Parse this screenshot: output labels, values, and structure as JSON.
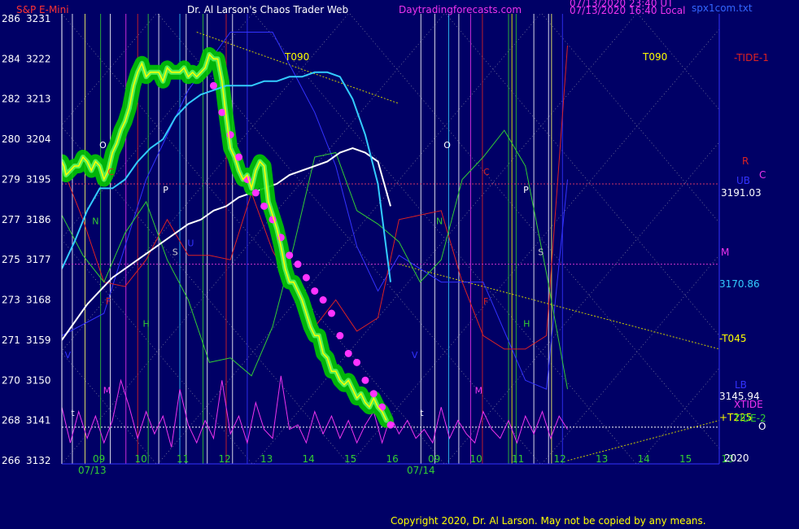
{
  "header": {
    "instrument": "S&P E-Mini",
    "site": "Dr. Al Larson's Chaos Trader Web",
    "url": "Daytradingforecasts.com",
    "stamp1": "07/13/2020 23:40 UT",
    "stamp2": "07/13/2020 16:40 Local",
    "file": "spx1com.txt"
  },
  "footer": {
    "copyright": "Copyright 2020, Dr. Al Larson. May not be copied by any means."
  },
  "colors": {
    "background": "#000066",
    "price": "#ffff00",
    "halo": "#00c800",
    "dots": "#ff33ff",
    "avg_fast": "#33ccff",
    "avg_slow": "#ffffff",
    "tide1": "#dd2222",
    "tide2": "#33cc33",
    "tide_blue": "#3333ff",
    "oscillator": "#ee33ee",
    "trend_dotted": "#cccc00"
  },
  "chart_data": {
    "type": "line",
    "title": "S&P E-Mini",
    "y_axis": {
      "left_labels": [
        "286",
        "284",
        "282",
        "280",
        "279",
        "277",
        "275",
        "273",
        "271",
        "270",
        "268",
        "266"
      ],
      "right_labels": [
        "3231",
        "3222",
        "3213",
        "3204",
        "3195",
        "3186",
        "3177",
        "3168",
        "3159",
        "3150",
        "3141",
        "3132"
      ],
      "ylim": [
        3132,
        3231
      ]
    },
    "x_axis": {
      "hour_labels": [
        "09",
        "10",
        "11",
        "12",
        "13",
        "14",
        "15",
        "16",
        "09",
        "10",
        "11",
        "12",
        "13",
        "14",
        "15",
        "13"
      ],
      "date_labels": [
        "07/13",
        "07/14"
      ]
    },
    "right_labels": [
      {
        "text": "-TIDE-1",
        "color": "#dd2222"
      },
      {
        "text": "R",
        "color": "#dd2222"
      },
      {
        "text": "UB",
        "color": "#3333ff"
      },
      {
        "text": "C",
        "color": "#ee33ee"
      },
      {
        "text": "3191.03",
        "color": "#ffffff"
      },
      {
        "text": "M",
        "color": "#ee33ee"
      },
      {
        "text": "3170.86",
        "color": "#33ccff"
      },
      {
        "text": "-T045",
        "color": "#ffff00"
      },
      {
        "text": "LB",
        "color": "#3333ff"
      },
      {
        "text": "3145.94",
        "color": "#ffffff"
      },
      {
        "text": "XTIDE",
        "color": "#ee33ee"
      },
      {
        "text": "+T225",
        "color": "#ffff00"
      },
      {
        "text": "TIDE-2",
        "color": "#33cc33"
      },
      {
        "text": "O",
        "color": "#ffffff"
      },
      {
        "text": "2020",
        "color": "#ffffff"
      }
    ],
    "top_labels": [
      "T090",
      "T090"
    ],
    "level_lines": [
      {
        "name": "R",
        "value": 3194,
        "color": "#cc3366"
      },
      {
        "name": "M",
        "value": 3176,
        "color": "#cc33cc"
      },
      {
        "name": "close",
        "value": 3139.5,
        "color": "#ffffff"
      }
    ],
    "planet_letters": [
      {
        "t": 0.89,
        "value": 3202,
        "text": "O",
        "color": "#ffffff"
      },
      {
        "t": 1.09,
        "value": 3196,
        "text": "C",
        "color": "#dd2222"
      },
      {
        "t": 0.72,
        "value": 3185,
        "text": "N",
        "color": "#33cc33"
      },
      {
        "t": 2.4,
        "value": 3192,
        "text": "P",
        "color": "#ffffff"
      },
      {
        "t": 2.62,
        "value": 3178,
        "text": "S",
        "color": "#cccccc"
      },
      {
        "t": 1.04,
        "value": 3167,
        "text": "F",
        "color": "#dd2222"
      },
      {
        "t": 1.92,
        "value": 3162,
        "text": "H",
        "color": "#33cc33"
      },
      {
        "t": 2.98,
        "value": 3180,
        "text": "U",
        "color": "#3333ff"
      },
      {
        "t": 0.07,
        "value": 3155,
        "text": "V",
        "color": "#3333ff"
      },
      {
        "t": 0.98,
        "value": 3147,
        "text": "M",
        "color": "#ee33ee"
      },
      {
        "t": 0.22,
        "value": 3142,
        "text": "t",
        "color": "#ffffff"
      },
      {
        "t": 9.06,
        "value": 3202,
        "text": "O",
        "color": "#ffffff"
      },
      {
        "t": 10.0,
        "value": 3196,
        "text": "C",
        "color": "#dd2222"
      },
      {
        "t": 8.88,
        "value": 3185,
        "text": "N",
        "color": "#33cc33"
      },
      {
        "t": 10.95,
        "value": 3192,
        "text": "P",
        "color": "#ffffff"
      },
      {
        "t": 11.3,
        "value": 3178,
        "text": "S",
        "color": "#cccccc"
      },
      {
        "t": 10.0,
        "value": 3167,
        "text": "F",
        "color": "#dd2222"
      },
      {
        "t": 10.95,
        "value": 3162,
        "text": "H",
        "color": "#33cc33"
      },
      {
        "t": 8.3,
        "value": 3155,
        "text": "V",
        "color": "#3333ff"
      },
      {
        "t": 9.8,
        "value": 3147,
        "text": "M",
        "color": "#ee33ee"
      },
      {
        "t": 8.5,
        "value": 3142,
        "text": "t",
        "color": "#ffffff"
      }
    ],
    "vertical_lines": [
      {
        "t": 0.25,
        "color": "#ffffff"
      },
      {
        "t": 0.55,
        "color": "#ffff66"
      },
      {
        "t": 0.92,
        "color": "#33cc33"
      },
      {
        "t": 1.15,
        "color": "#ffffff"
      },
      {
        "t": 1.52,
        "color": "#ee33ee"
      },
      {
        "t": 1.8,
        "color": "#dd2222"
      },
      {
        "t": 2.05,
        "color": "#33cc33"
      },
      {
        "t": 2.3,
        "color": "#ffffff"
      },
      {
        "t": 2.8,
        "color": "#33ccff"
      },
      {
        "t": 2.95,
        "color": "#ffffff"
      },
      {
        "t": 3.35,
        "color": "#33cc33"
      },
      {
        "t": 3.45,
        "color": "#ffffff"
      },
      {
        "t": 3.9,
        "color": "#dd2222"
      },
      {
        "t": 4.05,
        "color": "#ffffff"
      },
      {
        "t": 4.4,
        "color": "#3333ff"
      },
      {
        "t": 8.52,
        "color": "#ffffff"
      },
      {
        "t": 8.85,
        "color": "#ffffff"
      },
      {
        "t": 9.18,
        "color": "#33ccff"
      },
      {
        "t": 9.42,
        "color": "#ffffff"
      },
      {
        "t": 9.7,
        "color": "#ee33ee"
      },
      {
        "t": 9.98,
        "color": "#dd2222"
      },
      {
        "t": 10.6,
        "color": "#33cc33"
      },
      {
        "t": 10.68,
        "color": "#ffff00"
      },
      {
        "t": 10.78,
        "color": "#33cc33"
      },
      {
        "t": 11.2,
        "color": "#ffffff"
      },
      {
        "t": 11.55,
        "color": "#ffffff"
      },
      {
        "t": 11.62,
        "color": "#ffff66"
      },
      {
        "t": 11.88,
        "color": "#3333ff"
      }
    ],
    "series": [
      {
        "name": "price",
        "color": "#ffff00",
        "x": [
          0.0,
          0.05,
          0.1,
          0.2,
          0.3,
          0.4,
          0.5,
          0.6,
          0.7,
          0.8,
          0.9,
          1.0,
          1.1,
          1.2,
          1.3,
          1.4,
          1.5,
          1.6,
          1.7,
          1.8,
          1.9,
          2.0,
          2.1,
          2.2,
          2.3,
          2.4,
          2.5,
          2.6,
          2.7,
          2.8,
          2.9,
          3.0,
          3.1,
          3.2,
          3.3,
          3.4,
          3.5,
          3.6,
          3.7,
          3.8,
          3.9,
          4.0,
          4.1,
          4.2,
          4.3,
          4.4,
          4.5,
          4.6,
          4.7,
          4.8,
          4.9,
          5.0,
          5.1,
          5.2,
          5.3,
          5.4,
          5.5,
          5.6,
          5.7,
          5.8,
          5.9,
          6.0,
          6.1,
          6.2,
          6.3,
          6.4,
          6.5,
          6.6,
          6.7,
          6.8,
          6.9,
          7.0,
          7.1,
          7.2,
          7.3,
          7.4,
          7.5,
          7.6,
          7.7
        ],
        "values": [
          3199,
          3198,
          3196,
          3197,
          3198,
          3198,
          3200,
          3199,
          3197,
          3199,
          3198,
          3195,
          3197,
          3201,
          3203,
          3206,
          3208,
          3211,
          3216,
          3219,
          3221,
          3218,
          3219,
          3219,
          3219,
          3217,
          3220,
          3219,
          3219,
          3219,
          3220,
          3218,
          3219,
          3218,
          3219,
          3220,
          3223,
          3222,
          3222,
          3217,
          3209,
          3202,
          3200,
          3197,
          3195,
          3196,
          3193,
          3197,
          3199,
          3198,
          3190,
          3187,
          3184,
          3180,
          3175,
          3172,
          3172,
          3170,
          3168,
          3165,
          3162,
          3160,
          3160,
          3156,
          3155,
          3152,
          3152,
          3150,
          3149,
          3150,
          3148,
          3146,
          3147,
          3145,
          3144,
          3146,
          3144,
          3143,
          3141
        ]
      },
      {
        "name": "avg_fast",
        "color": "#33ccff",
        "x": [
          0.0,
          0.3,
          0.6,
          0.9,
          1.2,
          1.5,
          1.8,
          2.1,
          2.4,
          2.7,
          3.0,
          3.3,
          3.6,
          3.9,
          4.2,
          4.5,
          4.8,
          5.1,
          5.4,
          5.7,
          6.0,
          6.3,
          6.6,
          6.9,
          7.2,
          7.5,
          7.8
        ],
        "values": [
          3175,
          3181,
          3188,
          3193,
          3193,
          3195,
          3199,
          3202,
          3204,
          3209,
          3212,
          3214,
          3215,
          3216,
          3216,
          3216,
          3217,
          3217,
          3218,
          3218,
          3219,
          3219,
          3218,
          3213,
          3205,
          3194,
          3172
        ]
      },
      {
        "name": "avg_slow",
        "color": "#ffffff",
        "x": [
          0.0,
          0.3,
          0.6,
          0.9,
          1.2,
          1.5,
          1.8,
          2.1,
          2.4,
          2.7,
          3.0,
          3.3,
          3.6,
          3.9,
          4.2,
          4.5,
          4.8,
          5.1,
          5.4,
          5.7,
          6.0,
          6.3,
          6.6,
          6.9,
          7.2,
          7.5,
          7.8
        ],
        "values": [
          3159,
          3163,
          3167,
          3170,
          3173,
          3175,
          3177,
          3179,
          3181,
          3183,
          3185,
          3186,
          3188,
          3189,
          3191,
          3192,
          3193,
          3194,
          3196,
          3197,
          3198,
          3199,
          3201,
          3202,
          3201,
          3199,
          3189
        ]
      },
      {
        "name": "tide1",
        "color": "#dd2222",
        "x": [
          0.0,
          0.5,
          1.0,
          1.5,
          2.0,
          2.5,
          3.0,
          3.5,
          4.0,
          4.5,
          5.0,
          5.5,
          6.0,
          6.5,
          7.0,
          7.5,
          8.0,
          8.5,
          9.0,
          9.5,
          10.0,
          10.5,
          11.0,
          11.5,
          12.0
        ],
        "values": [
          3198,
          3186,
          3172,
          3171,
          3177,
          3186,
          3178,
          3178,
          3177,
          3192,
          3179,
          3171,
          3162,
          3168,
          3161,
          3164,
          3186,
          3187,
          3188,
          3172,
          3160,
          3157,
          3157,
          3160,
          3225
        ]
      },
      {
        "name": "tide2",
        "color": "#33cc33",
        "x": [
          0.0,
          0.5,
          1.0,
          1.5,
          2.0,
          2.5,
          3.0,
          3.5,
          4.0,
          4.5,
          5.0,
          5.5,
          6.0,
          6.5,
          7.0,
          7.5,
          8.0,
          8.5,
          9.0,
          9.5,
          10.0,
          10.5,
          11.0,
          11.5,
          12.0
        ],
        "values": [
          3187,
          3178,
          3172,
          3183,
          3190,
          3177,
          3168,
          3154,
          3155,
          3151,
          3162,
          3180,
          3200,
          3201,
          3188,
          3185,
          3181,
          3172,
          3177,
          3195,
          3200,
          3206,
          3198,
          3174,
          3148
        ]
      },
      {
        "name": "tide_blue",
        "color": "#3333ff",
        "x": [
          0.0,
          1.0,
          2.0,
          3.0,
          4.0,
          5.0,
          6.0,
          6.5,
          7.0,
          7.5,
          8.0,
          9.0,
          10.0,
          11.0,
          11.5,
          12.0
        ],
        "values": [
          3160,
          3165,
          3195,
          3215,
          3228,
          3228,
          3210,
          3198,
          3180,
          3170,
          3178,
          3172,
          3172,
          3150,
          3148,
          3195
        ]
      },
      {
        "name": "oscillator",
        "color": "#ee33ee",
        "x": [
          0.0,
          0.2,
          0.4,
          0.6,
          0.8,
          1.0,
          1.2,
          1.4,
          1.6,
          1.8,
          2.0,
          2.2,
          2.4,
          2.6,
          2.8,
          3.0,
          3.2,
          3.4,
          3.6,
          3.8,
          4.0,
          4.2,
          4.4,
          4.6,
          4.8,
          5.0,
          5.2,
          5.4,
          5.6,
          5.8,
          6.0,
          6.2,
          6.4,
          6.6,
          6.8,
          7.0,
          7.2,
          7.4,
          7.6,
          7.8,
          8.0,
          8.2,
          8.4,
          8.6,
          8.8,
          9.0,
          9.2,
          9.4,
          9.6,
          9.8,
          10.0,
          10.2,
          10.4,
          10.6,
          10.8,
          11.0,
          11.2,
          11.4,
          11.6,
          11.8,
          12.0
        ],
        "values": [
          3144,
          3136,
          3143,
          3137,
          3142,
          3136,
          3141,
          3150,
          3144,
          3137,
          3143,
          3138,
          3142,
          3135,
          3148,
          3140,
          3136,
          3141,
          3137,
          3150,
          3138,
          3142,
          3136,
          3145,
          3139,
          3137,
          3151,
          3139,
          3140,
          3136,
          3143,
          3138,
          3142,
          3137,
          3141,
          3136,
          3140,
          3143,
          3136,
          3142,
          3138,
          3141,
          3137,
          3139,
          3136,
          3144,
          3137,
          3141,
          3138,
          3136,
          3143,
          3139,
          3137,
          3141,
          3136,
          3142,
          3138,
          3143,
          3137,
          3142,
          3139
        ]
      },
      {
        "name": "dots",
        "color": "#ff33ff",
        "x": [
          3.6,
          3.8,
          4.0,
          4.2,
          4.4,
          4.6,
          4.8,
          5.0,
          5.2,
          5.4,
          5.6,
          5.8,
          6.0,
          6.2,
          6.4,
          6.6,
          6.8,
          7.0,
          7.2,
          7.4,
          7.6,
          7.8
        ],
        "values": [
          3216,
          3210,
          3205,
          3200,
          3195,
          3192,
          3189,
          3186,
          3182,
          3178,
          3176,
          3173,
          3170,
          3168,
          3165,
          3160,
          3156,
          3154,
          3150,
          3147,
          3144,
          3140
        ]
      }
    ],
    "trendlines": [
      {
        "x": [
          3.2,
          8.0
        ],
        "values": [
          3228,
          3212
        ],
        "color": "#cccc00"
      },
      {
        "x": [
          8.0,
          15.6
        ],
        "values": [
          3176,
          3157
        ],
        "color": "#cccc00"
      },
      {
        "x": [
          12.0,
          15.6
        ],
        "values": [
          3132,
          3141
        ],
        "color": "#cccc00"
      }
    ],
    "x_range": [
      0,
      15.6
    ],
    "grid": false,
    "legend": "none"
  }
}
